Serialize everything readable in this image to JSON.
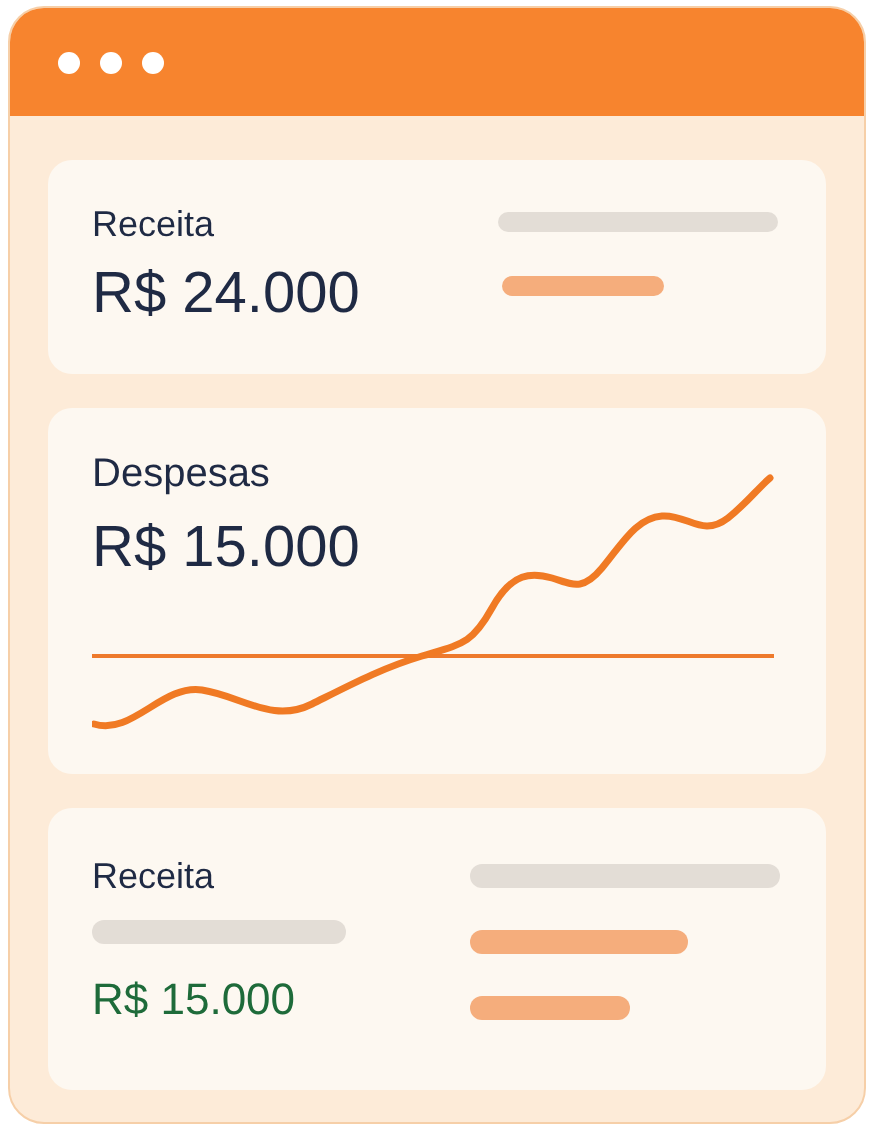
{
  "cards": [
    {
      "kind": "summary",
      "label": "Receita",
      "value": "R$ 24.000"
    },
    {
      "kind": "chart",
      "label": "Despesas",
      "value": "R$ 15.000"
    },
    {
      "kind": "detail",
      "label": "Receita",
      "value": "R$ 15.000"
    }
  ]
}
